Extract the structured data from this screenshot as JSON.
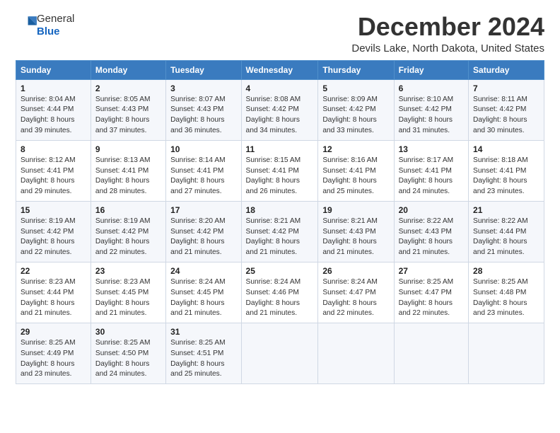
{
  "header": {
    "logo_line1": "General",
    "logo_line2": "Blue",
    "title": "December 2024",
    "subtitle": "Devils Lake, North Dakota, United States"
  },
  "calendar": {
    "days_of_week": [
      "Sunday",
      "Monday",
      "Tuesday",
      "Wednesday",
      "Thursday",
      "Friday",
      "Saturday"
    ],
    "weeks": [
      [
        {
          "day": "1",
          "content": "Sunrise: 8:04 AM\nSunset: 4:44 PM\nDaylight: 8 hours\nand 39 minutes."
        },
        {
          "day": "2",
          "content": "Sunrise: 8:05 AM\nSunset: 4:43 PM\nDaylight: 8 hours\nand 37 minutes."
        },
        {
          "day": "3",
          "content": "Sunrise: 8:07 AM\nSunset: 4:43 PM\nDaylight: 8 hours\nand 36 minutes."
        },
        {
          "day": "4",
          "content": "Sunrise: 8:08 AM\nSunset: 4:42 PM\nDaylight: 8 hours\nand 34 minutes."
        },
        {
          "day": "5",
          "content": "Sunrise: 8:09 AM\nSunset: 4:42 PM\nDaylight: 8 hours\nand 33 minutes."
        },
        {
          "day": "6",
          "content": "Sunrise: 8:10 AM\nSunset: 4:42 PM\nDaylight: 8 hours\nand 31 minutes."
        },
        {
          "day": "7",
          "content": "Sunrise: 8:11 AM\nSunset: 4:42 PM\nDaylight: 8 hours\nand 30 minutes."
        }
      ],
      [
        {
          "day": "8",
          "content": "Sunrise: 8:12 AM\nSunset: 4:41 PM\nDaylight: 8 hours\nand 29 minutes."
        },
        {
          "day": "9",
          "content": "Sunrise: 8:13 AM\nSunset: 4:41 PM\nDaylight: 8 hours\nand 28 minutes."
        },
        {
          "day": "10",
          "content": "Sunrise: 8:14 AM\nSunset: 4:41 PM\nDaylight: 8 hours\nand 27 minutes."
        },
        {
          "day": "11",
          "content": "Sunrise: 8:15 AM\nSunset: 4:41 PM\nDaylight: 8 hours\nand 26 minutes."
        },
        {
          "day": "12",
          "content": "Sunrise: 8:16 AM\nSunset: 4:41 PM\nDaylight: 8 hours\nand 25 minutes."
        },
        {
          "day": "13",
          "content": "Sunrise: 8:17 AM\nSunset: 4:41 PM\nDaylight: 8 hours\nand 24 minutes."
        },
        {
          "day": "14",
          "content": "Sunrise: 8:18 AM\nSunset: 4:41 PM\nDaylight: 8 hours\nand 23 minutes."
        }
      ],
      [
        {
          "day": "15",
          "content": "Sunrise: 8:19 AM\nSunset: 4:42 PM\nDaylight: 8 hours\nand 22 minutes."
        },
        {
          "day": "16",
          "content": "Sunrise: 8:19 AM\nSunset: 4:42 PM\nDaylight: 8 hours\nand 22 minutes."
        },
        {
          "day": "17",
          "content": "Sunrise: 8:20 AM\nSunset: 4:42 PM\nDaylight: 8 hours\nand 21 minutes."
        },
        {
          "day": "18",
          "content": "Sunrise: 8:21 AM\nSunset: 4:42 PM\nDaylight: 8 hours\nand 21 minutes."
        },
        {
          "day": "19",
          "content": "Sunrise: 8:21 AM\nSunset: 4:43 PM\nDaylight: 8 hours\nand 21 minutes."
        },
        {
          "day": "20",
          "content": "Sunrise: 8:22 AM\nSunset: 4:43 PM\nDaylight: 8 hours\nand 21 minutes."
        },
        {
          "day": "21",
          "content": "Sunrise: 8:22 AM\nSunset: 4:44 PM\nDaylight: 8 hours\nand 21 minutes."
        }
      ],
      [
        {
          "day": "22",
          "content": "Sunrise: 8:23 AM\nSunset: 4:44 PM\nDaylight: 8 hours\nand 21 minutes."
        },
        {
          "day": "23",
          "content": "Sunrise: 8:23 AM\nSunset: 4:45 PM\nDaylight: 8 hours\nand 21 minutes."
        },
        {
          "day": "24",
          "content": "Sunrise: 8:24 AM\nSunset: 4:45 PM\nDaylight: 8 hours\nand 21 minutes."
        },
        {
          "day": "25",
          "content": "Sunrise: 8:24 AM\nSunset: 4:46 PM\nDaylight: 8 hours\nand 21 minutes."
        },
        {
          "day": "26",
          "content": "Sunrise: 8:24 AM\nSunset: 4:47 PM\nDaylight: 8 hours\nand 22 minutes."
        },
        {
          "day": "27",
          "content": "Sunrise: 8:25 AM\nSunset: 4:47 PM\nDaylight: 8 hours\nand 22 minutes."
        },
        {
          "day": "28",
          "content": "Sunrise: 8:25 AM\nSunset: 4:48 PM\nDaylight: 8 hours\nand 23 minutes."
        }
      ],
      [
        {
          "day": "29",
          "content": "Sunrise: 8:25 AM\nSunset: 4:49 PM\nDaylight: 8 hours\nand 23 minutes."
        },
        {
          "day": "30",
          "content": "Sunrise: 8:25 AM\nSunset: 4:50 PM\nDaylight: 8 hours\nand 24 minutes."
        },
        {
          "day": "31",
          "content": "Sunrise: 8:25 AM\nSunset: 4:51 PM\nDaylight: 8 hours\nand 25 minutes."
        },
        {
          "day": "",
          "content": ""
        },
        {
          "day": "",
          "content": ""
        },
        {
          "day": "",
          "content": ""
        },
        {
          "day": "",
          "content": ""
        }
      ]
    ]
  }
}
